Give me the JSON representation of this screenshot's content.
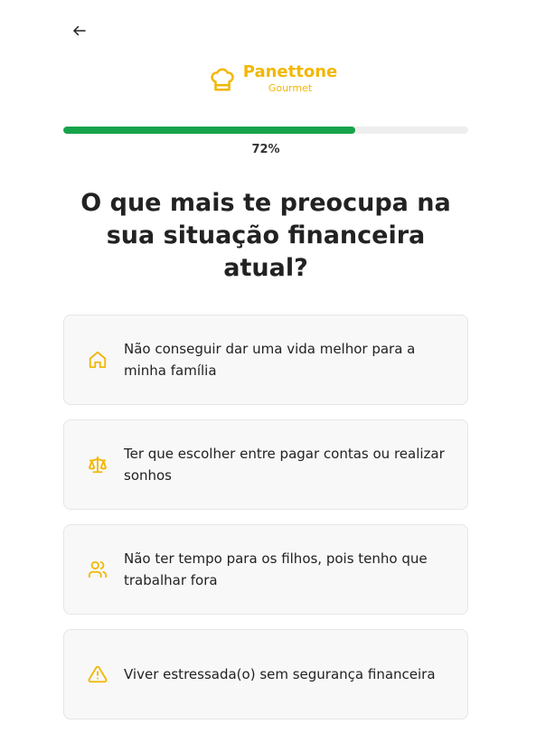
{
  "header": {
    "back_icon": "arrow-left-icon"
  },
  "brand": {
    "logo_icon": "chef-hat-icon",
    "name": "Panettone",
    "subtitle": "Gourmet",
    "color": "#f2b705"
  },
  "progress": {
    "percent": 72,
    "label": "72%",
    "fill_color": "#16a34a"
  },
  "question": {
    "title": "O que mais te preocupa na sua situação financeira atual?"
  },
  "options": [
    {
      "icon": "home-icon",
      "label": "Não conseguir dar uma vida melhor para a minha família"
    },
    {
      "icon": "scale-icon",
      "label": "Ter que escolher entre pagar contas ou realizar sonhos"
    },
    {
      "icon": "users-icon",
      "label": "Não ter tempo para os filhos, pois tenho que trabalhar fora"
    },
    {
      "icon": "alert-triangle-icon",
      "label": "Viver estressada(o) sem segurança financeira"
    }
  ],
  "accent_color": "#f2b705"
}
